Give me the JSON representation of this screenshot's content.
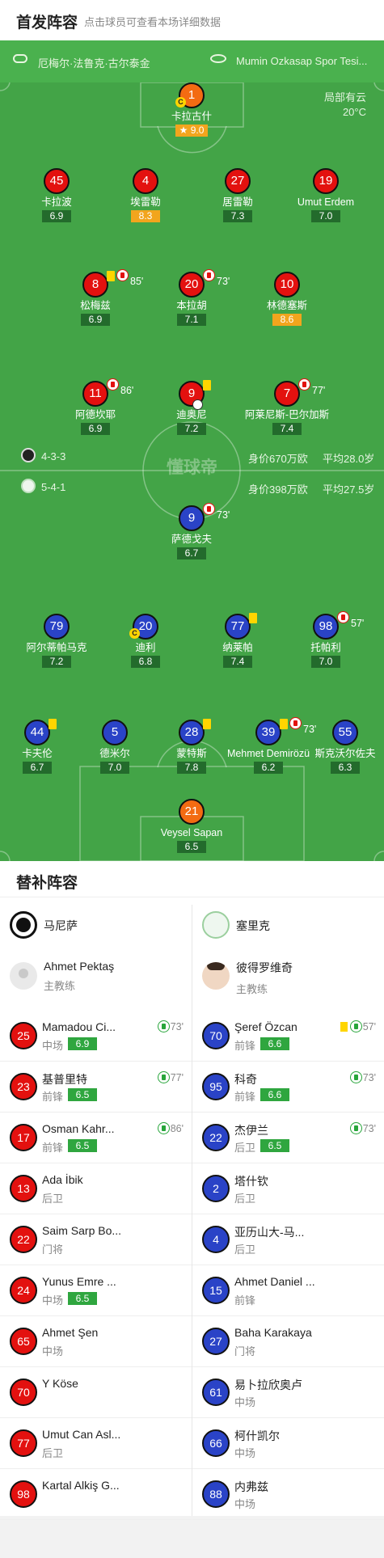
{
  "header": {
    "title": "首发阵容",
    "subtitle": "点击球员可查看本场详细数据"
  },
  "match_info": {
    "referee": "厄梅尔·法鲁克·古尔泰金",
    "venue": "Mumin Ozkasap Spor Tesi...",
    "weather": "局部有云",
    "temperature": "20°C"
  },
  "watermark": "懂球帝",
  "home_team": {
    "name": "马尼萨",
    "formation": "4-3-3",
    "value_text": "身价670万欧",
    "age_text": "平均28.0岁"
  },
  "away_team": {
    "name": "塞里克",
    "formation": "5-4-1",
    "value_text": "身价398万欧",
    "age_text": "平均27.5岁"
  },
  "pitch_players": [
    {
      "id": "p1",
      "num": "1",
      "name": "卡拉古什",
      "rating": "9.0",
      "color": "orange",
      "gold": true,
      "cap": true,
      "star": true
    },
    {
      "id": "p45",
      "num": "45",
      "name": "卡拉波",
      "rating": "6.9",
      "color": "red"
    },
    {
      "id": "p4",
      "num": "4",
      "name": "埃雷勒",
      "rating": "8.3",
      "color": "red",
      "gold": true
    },
    {
      "id": "p27",
      "num": "27",
      "name": "居雷勒",
      "rating": "7.3",
      "color": "red"
    },
    {
      "id": "p19",
      "num": "19",
      "name": "Umut Erdem",
      "rating": "7.0",
      "color": "red"
    },
    {
      "id": "p8",
      "num": "8",
      "name": "松梅兹",
      "rating": "6.9",
      "color": "red",
      "yellow": true,
      "sub": "85'"
    },
    {
      "id": "p20h",
      "num": "20",
      "name": "本拉胡",
      "rating": "7.1",
      "color": "red",
      "sub": "73'"
    },
    {
      "id": "p10",
      "num": "10",
      "name": "林德塞斯",
      "rating": "8.6",
      "color": "red",
      "gold": true
    },
    {
      "id": "p11",
      "num": "11",
      "name": "阿德坎耶",
      "rating": "6.9",
      "color": "red",
      "sub": "86'"
    },
    {
      "id": "p9h",
      "num": "9",
      "name": "迪奥尼",
      "rating": "7.2",
      "color": "red",
      "yellow": true,
      "goal": true
    },
    {
      "id": "p7",
      "num": "7",
      "name": "阿莱尼斯-巴尔加斯",
      "rating": "7.4",
      "color": "red",
      "sub": "77'"
    },
    {
      "id": "p9a",
      "num": "9",
      "name": "萨德戈夫",
      "rating": "6.7",
      "color": "blue",
      "sub": "73'"
    },
    {
      "id": "p79",
      "num": "79",
      "name": "阿尔蒂帕马克",
      "rating": "7.2",
      "color": "blue"
    },
    {
      "id": "p20a",
      "num": "20",
      "name": "迪利",
      "rating": "6.8",
      "color": "blue",
      "cap": true
    },
    {
      "id": "p77",
      "num": "77",
      "name": "纳莱帕",
      "rating": "7.4",
      "color": "blue",
      "yellow": true
    },
    {
      "id": "p98",
      "num": "98",
      "name": "托帕利",
      "rating": "7.0",
      "color": "blue",
      "sub": "57'"
    },
    {
      "id": "p44",
      "num": "44",
      "name": "卡夫伦",
      "rating": "6.7",
      "color": "blue",
      "yellow": true
    },
    {
      "id": "p5",
      "num": "5",
      "name": "德米尔",
      "rating": "7.0",
      "color": "blue"
    },
    {
      "id": "p28",
      "num": "28",
      "name": "蒙特斯",
      "rating": "7.8",
      "color": "blue",
      "yellow": true
    },
    {
      "id": "p39",
      "num": "39",
      "name": "Mehmet Demirözü",
      "rating": "6.2",
      "color": "blue",
      "yellow": true,
      "sub": "73'"
    },
    {
      "id": "p55",
      "num": "55",
      "name": "斯克沃尔佐夫",
      "rating": "6.3",
      "color": "blue"
    },
    {
      "id": "p21",
      "num": "21",
      "name": "Veysel Sapan",
      "rating": "6.5",
      "color": "orange"
    }
  ],
  "subs_title": "替补阵容",
  "home_coach": {
    "name": "Ahmet Pektaş",
    "role": "主教练"
  },
  "away_coach": {
    "name": "彼得罗维奇",
    "role": "主教练"
  },
  "home_subs": [
    {
      "num": "25",
      "name": "Mamadou Ci...",
      "pos": "中场",
      "rating": "6.9",
      "event": "73'"
    },
    {
      "num": "23",
      "name": "基普里特",
      "pos": "前锋",
      "rating": "6.5",
      "event": "77'"
    },
    {
      "num": "17",
      "name": "Osman Kahr...",
      "pos": "前锋",
      "rating": "6.5",
      "event": "86'"
    },
    {
      "num": "13",
      "name": "Ada İbik",
      "pos": "后卫"
    },
    {
      "num": "22",
      "name": "Saim Sarp Bo...",
      "pos": "门将"
    },
    {
      "num": "24",
      "name": "Yunus Emre ...",
      "pos": "中场",
      "rating": "6.5"
    },
    {
      "num": "65",
      "name": "Ahmet Şen",
      "pos": "中场"
    },
    {
      "num": "70",
      "name": "Y Köse",
      "pos": ""
    },
    {
      "num": "77",
      "name": "Umut Can Asl...",
      "pos": "后卫"
    },
    {
      "num": "98",
      "name": "Kartal Alkiş G...",
      "pos": ""
    }
  ],
  "away_subs": [
    {
      "num": "70",
      "name": "Şeref Özcan",
      "pos": "前锋",
      "rating": "6.6",
      "event": "57'",
      "yellow": true
    },
    {
      "num": "95",
      "name": "科奇",
      "pos": "前锋",
      "rating": "6.6",
      "event": "73'"
    },
    {
      "num": "22",
      "name": "杰伊兰",
      "pos": "后卫",
      "rating": "6.5",
      "event": "73'"
    },
    {
      "num": "2",
      "name": "塔什钦",
      "pos": "后卫"
    },
    {
      "num": "4",
      "name": "亚历山大-马...",
      "pos": "后卫"
    },
    {
      "num": "15",
      "name": "Ahmet Daniel ...",
      "pos": "前锋"
    },
    {
      "num": "27",
      "name": "Baha Karakaya",
      "pos": "门将"
    },
    {
      "num": "61",
      "name": "易卜拉欣奥卢",
      "pos": "中场"
    },
    {
      "num": "66",
      "name": "柯什凯尔",
      "pos": "中场"
    },
    {
      "num": "88",
      "name": "内弗兹",
      "pos": "中场"
    }
  ],
  "colors": {
    "pitch": "#43a447",
    "home": "#e3110f",
    "away": "#2a43c7",
    "keeper": "#f36b12",
    "gold_rating": "#f2a51d"
  }
}
